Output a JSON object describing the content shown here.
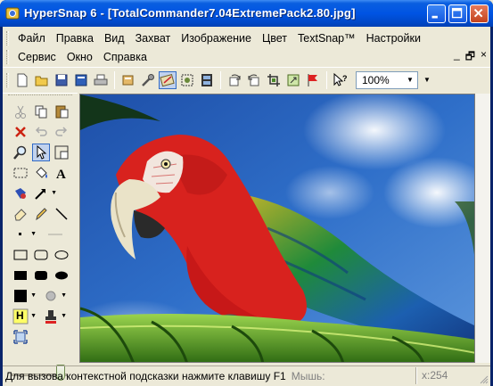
{
  "window": {
    "title": "HyperSnap 6 - [TotalCommander7.04ExtremePack2.80.jpg]"
  },
  "menu": {
    "row1": [
      "Файл",
      "Правка",
      "Вид",
      "Захват",
      "Изображение",
      "Цвет",
      "TextSnap™",
      "Настройки"
    ],
    "row2": [
      "Сервис",
      "Окно",
      "Справка"
    ],
    "mdi_controls": [
      "_",
      "🗗",
      "×"
    ]
  },
  "toolbar": {
    "icons": [
      "new-icon",
      "open-icon",
      "save-icon",
      "book-icon",
      "print-icon",
      "capture-settings-icon",
      "tools-icon",
      "snap-active-icon",
      "region-icon",
      "film-icon",
      "rotate-right-icon",
      "rotate-left-icon",
      "crop-icon",
      "resize-icon",
      "flag-icon",
      "help-cursor-icon"
    ],
    "zoom_value": "100%"
  },
  "tools": {
    "icons": [
      "cut-icon",
      "copy-icon",
      "paste-icon",
      "delete-icon",
      "undo-icon",
      "redo-icon",
      "zoom-icon",
      "pointer-icon",
      "select-frame-icon",
      "rect-select-icon",
      "fill-icon",
      "text-icon",
      "stamp-icon",
      "arrow-icon",
      "eraser-icon",
      "pencil-icon",
      "line-icon",
      "dot-icon",
      "rect-icon",
      "rounded-rect-icon",
      "ellipse-icon",
      "filled-rect-icon",
      "filled-rounded-rect-icon",
      "filled-ellipse-icon",
      "color-black-icon",
      "color-gray-icon",
      "highlight-icon",
      "stamp-red-icon",
      "fit-icon"
    ],
    "highlight_letter": "H"
  },
  "status": {
    "message": "Для вызова контекстной подсказки нажмите клавишу F1",
    "mouse_label": "Мышь:",
    "coord": "x:254"
  },
  "colors": {
    "titlebar": "#0054E3",
    "chrome": "#ECE9D8",
    "selection": "#316AC5",
    "sky": "#2F6FC9",
    "parrot_red": "#D8221E"
  }
}
